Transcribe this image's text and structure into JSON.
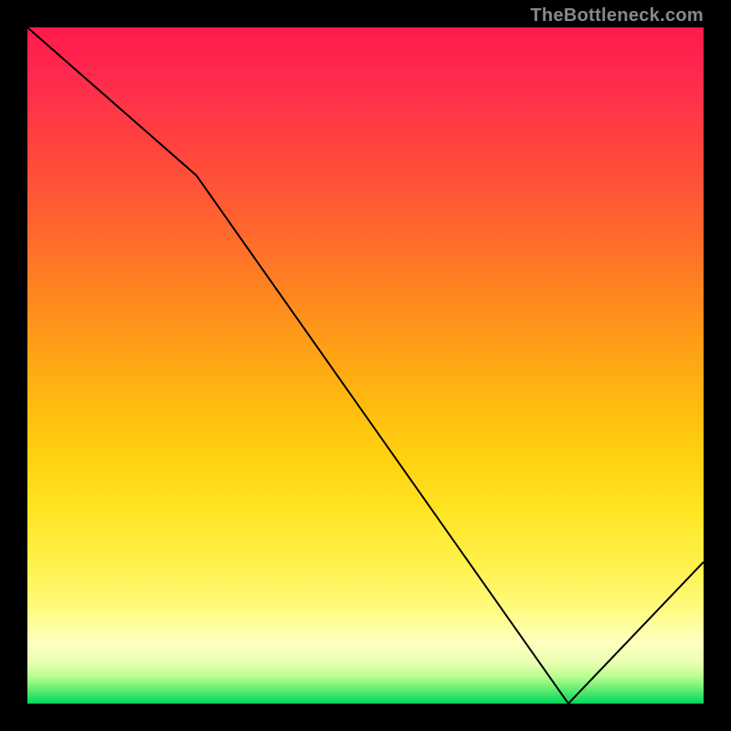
{
  "attribution": "TheBottleneck.com",
  "chart_data": {
    "type": "line",
    "title": "",
    "xlabel": "",
    "ylabel": "",
    "x": [
      0,
      25,
      80,
      100
    ],
    "values": [
      105,
      82,
      0,
      22
    ],
    "ylim": [
      0,
      105
    ],
    "xlim": [
      0,
      100
    ],
    "minimum_label": "",
    "minimum_x_percent": 80,
    "colors": {
      "curve": "#000000",
      "top": "#ff1a4d",
      "bottom": "#00d860"
    }
  }
}
